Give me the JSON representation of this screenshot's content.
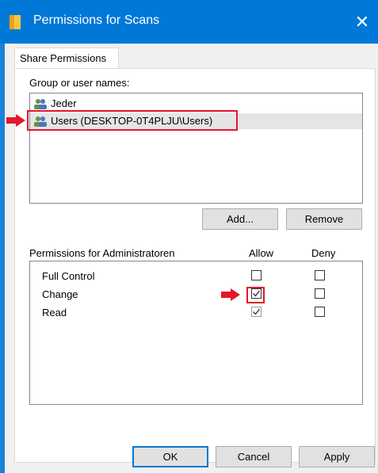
{
  "window": {
    "title": "Permissions for Scans",
    "close_symbol": "✕",
    "title_icon": "folder-icon",
    "accent_color": "#0078d7"
  },
  "tabs": [
    {
      "label": "Share Permissions"
    }
  ],
  "group_section": {
    "label": "Group or user names:",
    "users": [
      {
        "name": "Jeder",
        "icon": "users-icon",
        "selected": false
      },
      {
        "name": "Users (DESKTOP-0T4PLJU\\Users)",
        "icon": "users-icon",
        "selected": true
      }
    ],
    "add_button": "Add...",
    "remove_button": "Remove"
  },
  "permissions_section": {
    "header": "Permissions for Administratoren",
    "allow_header": "Allow",
    "deny_header": "Deny",
    "rows": [
      {
        "name": "Full Control",
        "allow": false,
        "deny": false
      },
      {
        "name": "Change",
        "allow": true,
        "deny": false
      },
      {
        "name": "Read",
        "allow": true,
        "deny": false
      }
    ]
  },
  "footer": {
    "ok": "OK",
    "cancel": "Cancel",
    "apply": "Apply"
  },
  "annotations": {
    "highlight_color": "#e5162b"
  }
}
